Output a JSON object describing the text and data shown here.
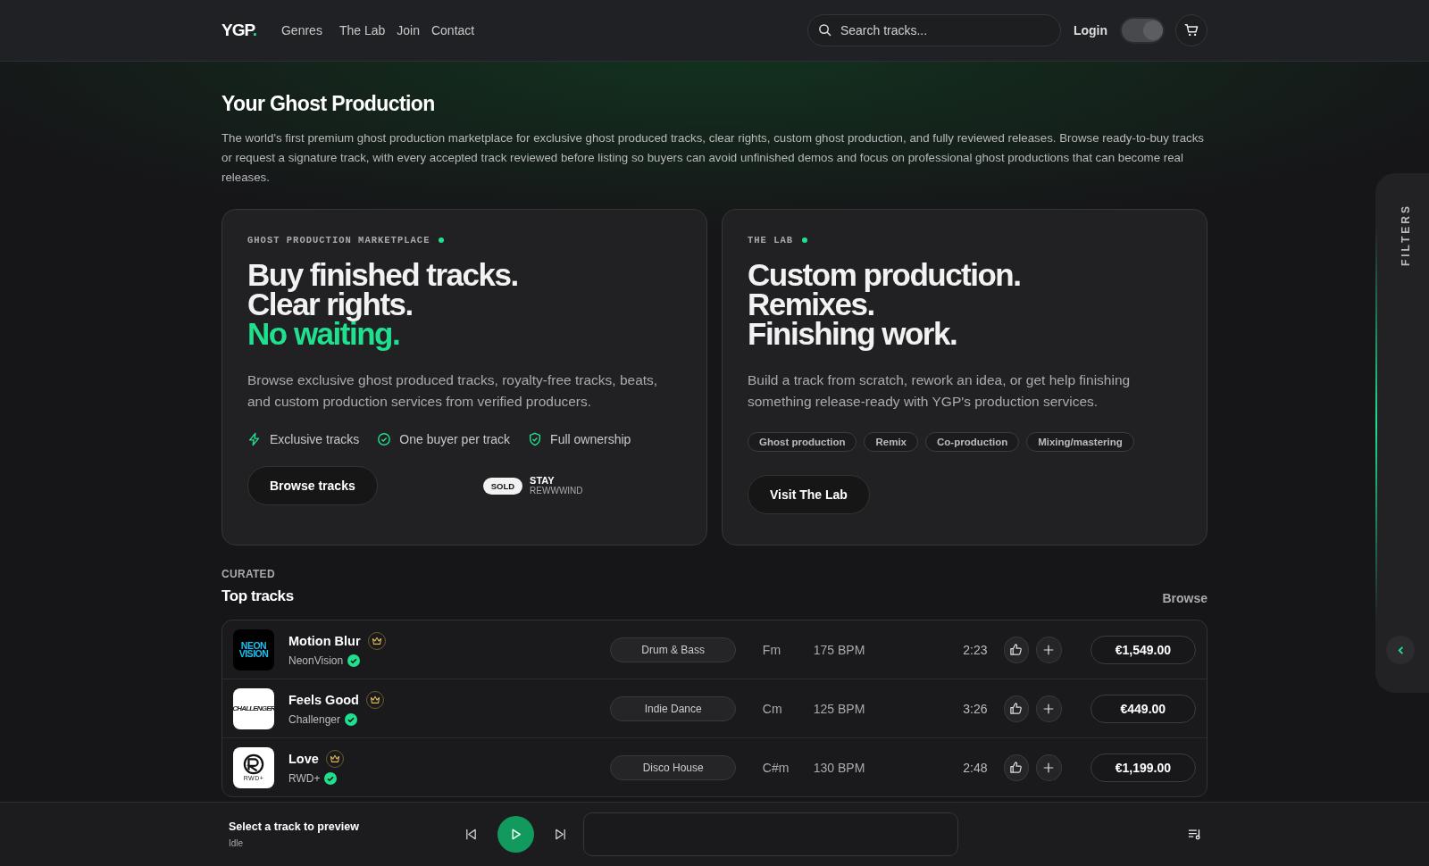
{
  "header": {
    "logo": "YGP",
    "logo_dot": ".",
    "nav": [
      "Genres",
      "The Lab",
      "Join",
      "Contact"
    ],
    "search": {
      "placeholder": "Search tracks..."
    },
    "login": "Login",
    "theme_toggle": {
      "on": true
    }
  },
  "intro": {
    "title": "Your Ghost Production",
    "text": "The world's first premium ghost production marketplace for exclusive ghost produced tracks, clear rights, custom ghost production, and fully reviewed releases. Browse ready-to-buy tracks or request a signature track, with every accepted track reviewed before listing so buyers can avoid unfinished demos and focus on professional ghost productions that can become real releases."
  },
  "cards": [
    {
      "kind": "marketplace",
      "eyebrow": "GHOST PRODUCTION MARKETPLACE",
      "headline": [
        {
          "text": "Buy finished tracks.",
          "accent": false
        },
        {
          "text": "Clear rights.",
          "accent": false
        },
        {
          "text": "No waiting.",
          "accent": true
        }
      ],
      "body": "Browse exclusive ghost produced tracks, royalty-free tracks, beats, and custom production services from verified producers.",
      "features": [
        {
          "label": "Exclusive tracks"
        },
        {
          "label": "One buyer per track"
        },
        {
          "label": "Full ownership"
        }
      ],
      "button": "Browse tracks",
      "sold": {
        "badge": "SOLD",
        "title": "STAY",
        "artist": "REWWWIND"
      }
    },
    {
      "kind": "lab",
      "eyebrow": "THE LAB",
      "headline": [
        {
          "text": "Custom production.",
          "accent": false
        },
        {
          "text": "Remixes.",
          "accent": false
        },
        {
          "text": "Finishing work.",
          "accent": false
        }
      ],
      "body": "Build a track from scratch, rework an idea, or get help finishing something release-ready with YGP's production services.",
      "tags": [
        "Ghost production",
        "Remix",
        "Co-production",
        "Mixing/mastering"
      ],
      "button": "Visit The Lab"
    }
  ],
  "top_tracks": {
    "eyebrow": "CURATED",
    "title": "Top tracks",
    "link": "Browse",
    "rows": [
      {
        "title": "Motion Blur",
        "artist": "NeonVision",
        "verified": true,
        "logo": {
          "text": "NEON VISION"
        },
        "genre": "Drum & Bass",
        "key": "Fm",
        "bpm": "175 BPM",
        "time": "2:23",
        "price": "€1,549.00"
      },
      {
        "title": "Feels Good",
        "artist": "Challenger",
        "verified": true,
        "logo": {
          "text": "CHALLENGER"
        },
        "genre": "Indie Dance",
        "key": "Cm",
        "bpm": "125 BPM",
        "time": "3:26",
        "price": "€449.00"
      },
      {
        "title": "Love",
        "artist": "RWD+",
        "verified": true,
        "logo": {
          "text": "RWD+"
        },
        "genre": "Disco House",
        "key": "C#m",
        "bpm": "130 BPM",
        "time": "2:48",
        "price": "€1,199.00"
      }
    ]
  },
  "filters": {
    "label": "FILTERS"
  },
  "player": {
    "title": "Select a track to preview",
    "status": "Idle",
    "playing": false
  }
}
